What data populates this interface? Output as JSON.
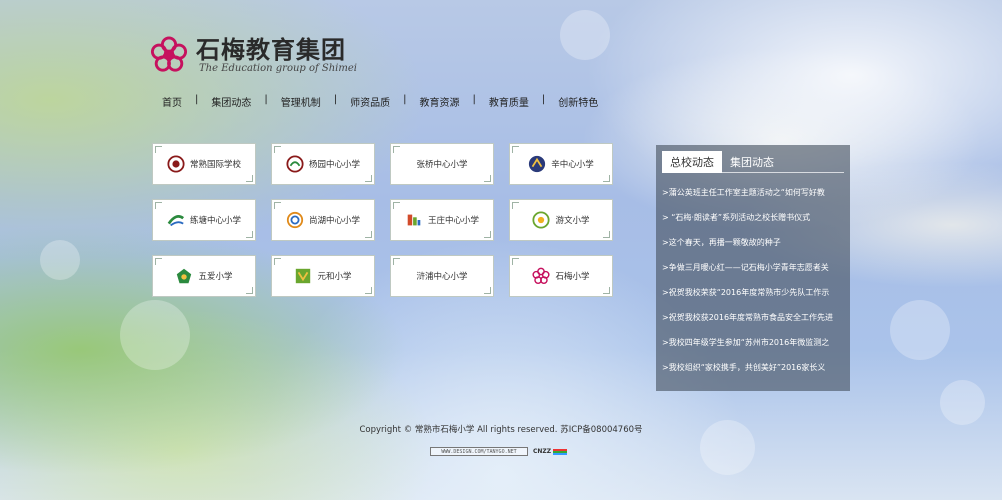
{
  "logo": {
    "title_cn": "石梅教育集团",
    "title_en": "The Education group of Shimei",
    "brand_color": "#c6115e"
  },
  "nav": {
    "items": [
      "首页",
      "集团动态",
      "管理机制",
      "师资品质",
      "教育资源",
      "教育质量",
      "创新特色"
    ],
    "separator": "|"
  },
  "schools": [
    {
      "label": "常熟国际学校",
      "icon": "school-crest-icon",
      "color": "#8a1a1a"
    },
    {
      "label": "杨园中心小学",
      "icon": "school-crest-icon",
      "color": "#8a1a1a"
    },
    {
      "label": "张桥中心小学",
      "icon": "",
      "color": ""
    },
    {
      "label": "辛中心小学",
      "icon": "school-crest-icon",
      "color": "#2a3a7a"
    },
    {
      "label": "练塘中心小学",
      "icon": "school-crest-icon",
      "color": "#2b8a3e"
    },
    {
      "label": "尚湖中心小学",
      "icon": "school-crest-icon",
      "color": "#e08a1a"
    },
    {
      "label": "王庄中心小学",
      "icon": "school-crest-icon",
      "color": "#d24b2a"
    },
    {
      "label": "游文小学",
      "icon": "school-crest-icon",
      "color": "#6aa62e"
    },
    {
      "label": "五爱小学",
      "icon": "school-crest-icon",
      "color": "#2b8a3e"
    },
    {
      "label": "元和小学",
      "icon": "school-crest-icon",
      "color": "#6aa62e"
    },
    {
      "label": "浒浦中心小学",
      "icon": "",
      "color": ""
    },
    {
      "label": "石梅小学",
      "icon": "school-crest-icon",
      "color": "#c6115e"
    }
  ],
  "news": {
    "tabs": [
      "总校动态",
      "集团动态"
    ],
    "active_tab": 0,
    "items": [
      ">蒲公英班主任工作室主题活动之“如何写好教",
      "> “石梅·朗读者”系列活动之校长赠书仪式",
      ">这个春天，再播一颗敬故的种子",
      ">争做三月暖心红——记石梅小学青年志愿者关",
      ">祝贺我校荣获“2016年度常熟市少先队工作示",
      ">祝贺我校获2016年度常熟市食品安全工作先进",
      ">我校四年级学生参加“苏州市2016年微监测之",
      ">我校组织“家校携手，共创美好”2016家长义"
    ]
  },
  "footer": {
    "copyright": "Copyright © 常熟市石梅小学 All rights reserved. 苏ICP备08004760号",
    "badge1": "WWW.DESIGN.COM/TANYGO.NET",
    "badge2": "CNZZ"
  }
}
